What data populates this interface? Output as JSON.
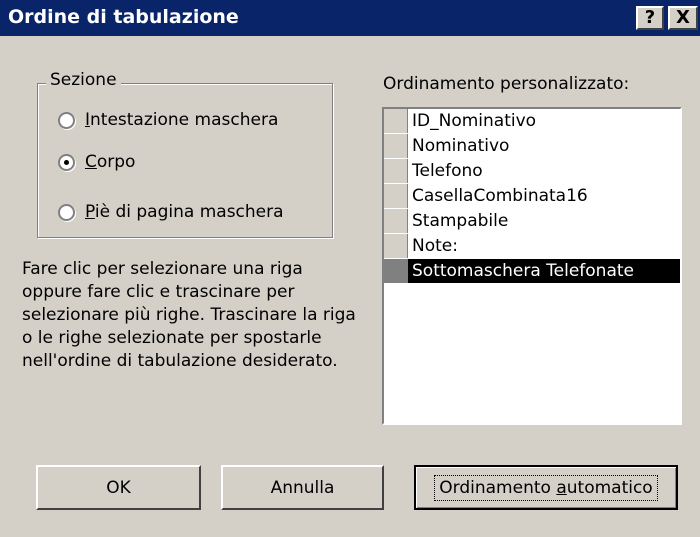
{
  "window": {
    "title": "Ordine di tabulazione",
    "help_btn": "?",
    "close_btn": "X"
  },
  "section": {
    "label": "Sezione",
    "options": [
      {
        "label": "Intestazione maschera",
        "accel": "I",
        "checked": false
      },
      {
        "label": "Corpo",
        "accel": "C",
        "checked": true
      },
      {
        "label": "Piè di pagina maschera",
        "accel": "P",
        "checked": false
      }
    ]
  },
  "help_text": "Fare clic per selezionare una riga oppure fare clic e trascinare per selezionare più righe. Trascinare la riga o le righe selezionate per spostarle nell'ordine di tabulazione desiderato.",
  "custom_order": {
    "label": "Ordinamento personalizzato:",
    "items": [
      "ID_Nominativo",
      "Nominativo",
      "Telefono",
      "CasellaCombinata16",
      "Stampabile",
      "Note:",
      "Sottomaschera Telefonate"
    ],
    "selected_index": 6
  },
  "buttons": {
    "ok": "OK",
    "cancel": "Annulla",
    "auto_order": "Ordinamento automatico"
  }
}
